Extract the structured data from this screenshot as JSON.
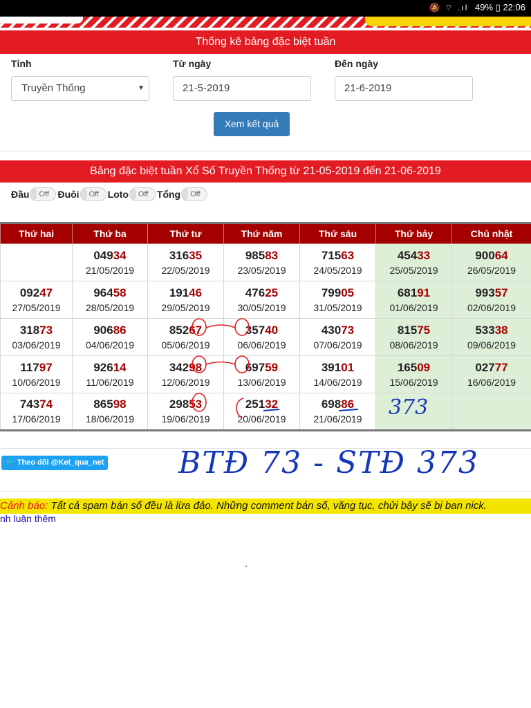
{
  "statusbar": {
    "battery": "49%",
    "time": "22:06",
    "icons": "🔕 ⌔ .ıl"
  },
  "search": {
    "title": "Thống kê bảng đặc biệt tuần",
    "province_label": "Tỉnh",
    "province_value": "Truyền Thống",
    "from_label": "Từ ngày",
    "from_value": "21-5-2019",
    "to_label": "Đến ngày",
    "to_value": "21-6-2019",
    "submit_label": "Xem kết quả"
  },
  "result": {
    "title": "Bảng đặc biệt tuần Xổ Số Truyền Thống từ 21-05-2019 đến 21-06-2019",
    "toggles": [
      {
        "label": "Đầu",
        "state": "Off"
      },
      {
        "label": "Đuôi",
        "state": "Off"
      },
      {
        "label": "Loto",
        "state": "Off"
      },
      {
        "label": "Tổng",
        "state": "Off"
      }
    ],
    "days": [
      "Thứ hai",
      "Thứ ba",
      "Thứ tư",
      "Thứ năm",
      "Thứ sáu",
      "Thứ bảy",
      "Chủ nhật"
    ],
    "rows": [
      [
        {
          "head": "",
          "tail": "",
          "date": ""
        },
        {
          "head": "049",
          "tail": "34",
          "date": "21/05/2019"
        },
        {
          "head": "316",
          "tail": "35",
          "date": "22/05/2019"
        },
        {
          "head": "985",
          "tail": "83",
          "date": "23/05/2019"
        },
        {
          "head": "715",
          "tail": "63",
          "date": "24/05/2019"
        },
        {
          "head": "454",
          "tail": "33",
          "date": "25/05/2019"
        },
        {
          "head": "900",
          "tail": "64",
          "date": "26/05/2019"
        }
      ],
      [
        {
          "head": "092",
          "tail": "47",
          "date": "27/05/2019"
        },
        {
          "head": "964",
          "tail": "58",
          "date": "28/05/2019"
        },
        {
          "head": "191",
          "tail": "46",
          "date": "29/05/2019"
        },
        {
          "head": "476",
          "tail": "25",
          "date": "30/05/2019"
        },
        {
          "head": "799",
          "tail": "05",
          "date": "31/05/2019"
        },
        {
          "head": "681",
          "tail": "91",
          "date": "01/06/2019"
        },
        {
          "head": "993",
          "tail": "57",
          "date": "02/06/2019"
        }
      ],
      [
        {
          "head": "318",
          "tail": "73",
          "date": "03/06/2019"
        },
        {
          "head": "906",
          "tail": "86",
          "date": "04/06/2019"
        },
        {
          "head": "852",
          "tail": "67",
          "date": "05/06/2019"
        },
        {
          "head": "357",
          "tail": "40",
          "date": "06/06/2019"
        },
        {
          "head": "430",
          "tail": "73",
          "date": "07/06/2019"
        },
        {
          "head": "815",
          "tail": "75",
          "date": "08/06/2019"
        },
        {
          "head": "533",
          "tail": "38",
          "date": "09/06/2019"
        }
      ],
      [
        {
          "head": "117",
          "tail": "97",
          "date": "10/06/2019"
        },
        {
          "head": "926",
          "tail": "14",
          "date": "11/06/2019"
        },
        {
          "head": "342",
          "tail": "98",
          "date": "12/06/2019"
        },
        {
          "head": "697",
          "tail": "59",
          "date": "13/06/2019"
        },
        {
          "head": "391",
          "tail": "01",
          "date": "14/06/2019"
        },
        {
          "head": "165",
          "tail": "09",
          "date": "15/06/2019"
        },
        {
          "head": "027",
          "tail": "77",
          "date": "16/06/2019"
        }
      ],
      [
        {
          "head": "743",
          "tail": "74",
          "date": "17/06/2019"
        },
        {
          "head": "865",
          "tail": "98",
          "date": "18/06/2019"
        },
        {
          "head": "298",
          "tail": "53",
          "date": "19/06/2019"
        },
        {
          "head": "251",
          "tail": "32",
          "date": "20/06/2019"
        },
        {
          "head": "698",
          "tail": "86",
          "date": "21/06/2019"
        },
        {
          "head": "",
          "tail": "",
          "date": ""
        },
        {
          "head": "",
          "tail": "",
          "date": ""
        }
      ]
    ]
  },
  "annotations": {
    "cell_note": "373",
    "headline": "BTĐ 73 - STĐ 373",
    "color": "#1437b8"
  },
  "twitter": {
    "label": "Theo dõi @Ket_qua_net",
    "icon": "twitter-bird-icon"
  },
  "warning": {
    "label": "Cảnh báo:",
    "text": " Tất cả spam bán số đều là lừa đảo. Những comment bán số, văng tục, chửi bậy sẽ bị ban nick."
  },
  "more_comments": "nh luận thêm",
  "colors": {
    "brand_red": "#e31b23",
    "tail_red": "#a50000",
    "weekend_green": "#deefd8",
    "button_blue": "#337ab7"
  }
}
